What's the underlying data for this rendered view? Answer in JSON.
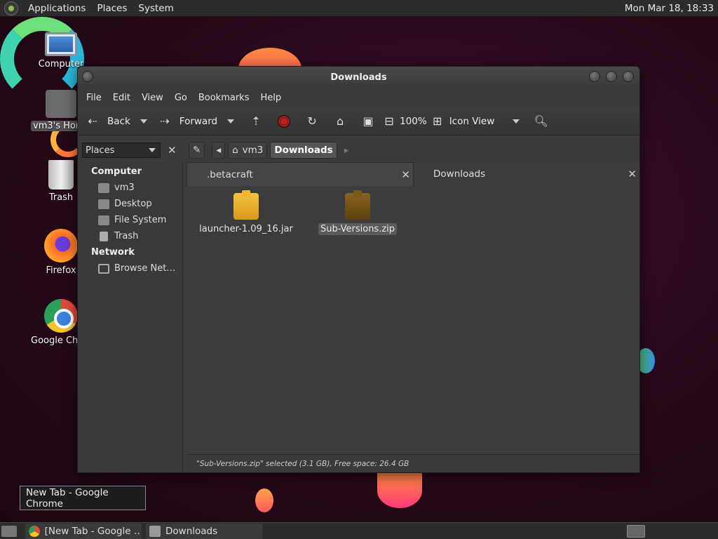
{
  "top_panel": {
    "menus": [
      "Applications",
      "Places",
      "System"
    ],
    "clock": "Mon Mar 18, 18:33"
  },
  "desktop": {
    "icons": [
      {
        "label": "Computer",
        "icon": "computer-icon"
      },
      {
        "label": "vm3's Home",
        "icon": "home-folder-icon"
      },
      {
        "label": "Trash",
        "icon": "trash-icon"
      },
      {
        "label": "Firefox",
        "icon": "firefox-icon"
      },
      {
        "label": "Google Chrome",
        "icon": "chrome-icon"
      }
    ]
  },
  "window": {
    "title": "Downloads",
    "menubar": [
      "File",
      "Edit",
      "View",
      "Go",
      "Bookmarks",
      "Help"
    ],
    "toolbar": {
      "back": "Back",
      "forward": "Forward",
      "zoom": "100%",
      "view_mode": "Icon View"
    },
    "sidebar": {
      "selector": "Places",
      "sections": [
        {
          "heading": "Computer",
          "items": [
            "vm3",
            "Desktop",
            "File System",
            "Trash"
          ]
        },
        {
          "heading": "Network",
          "items": [
            "Browse Net…"
          ]
        }
      ]
    },
    "path": [
      "vm3",
      "Downloads"
    ],
    "tabs": [
      ".betacraft",
      "Downloads"
    ],
    "files": [
      {
        "name": "launcher-1.09_16.jar"
      },
      {
        "name": "Sub-Versions.zip",
        "selected": true
      }
    ],
    "status": "\"Sub-Versions.zip\" selected (3.1 GB), Free space: 26.4 GB"
  },
  "tooltip": "New Tab - Google Chrome",
  "taskbar": {
    "tasks": [
      "[New Tab - Google …",
      "Downloads"
    ]
  }
}
